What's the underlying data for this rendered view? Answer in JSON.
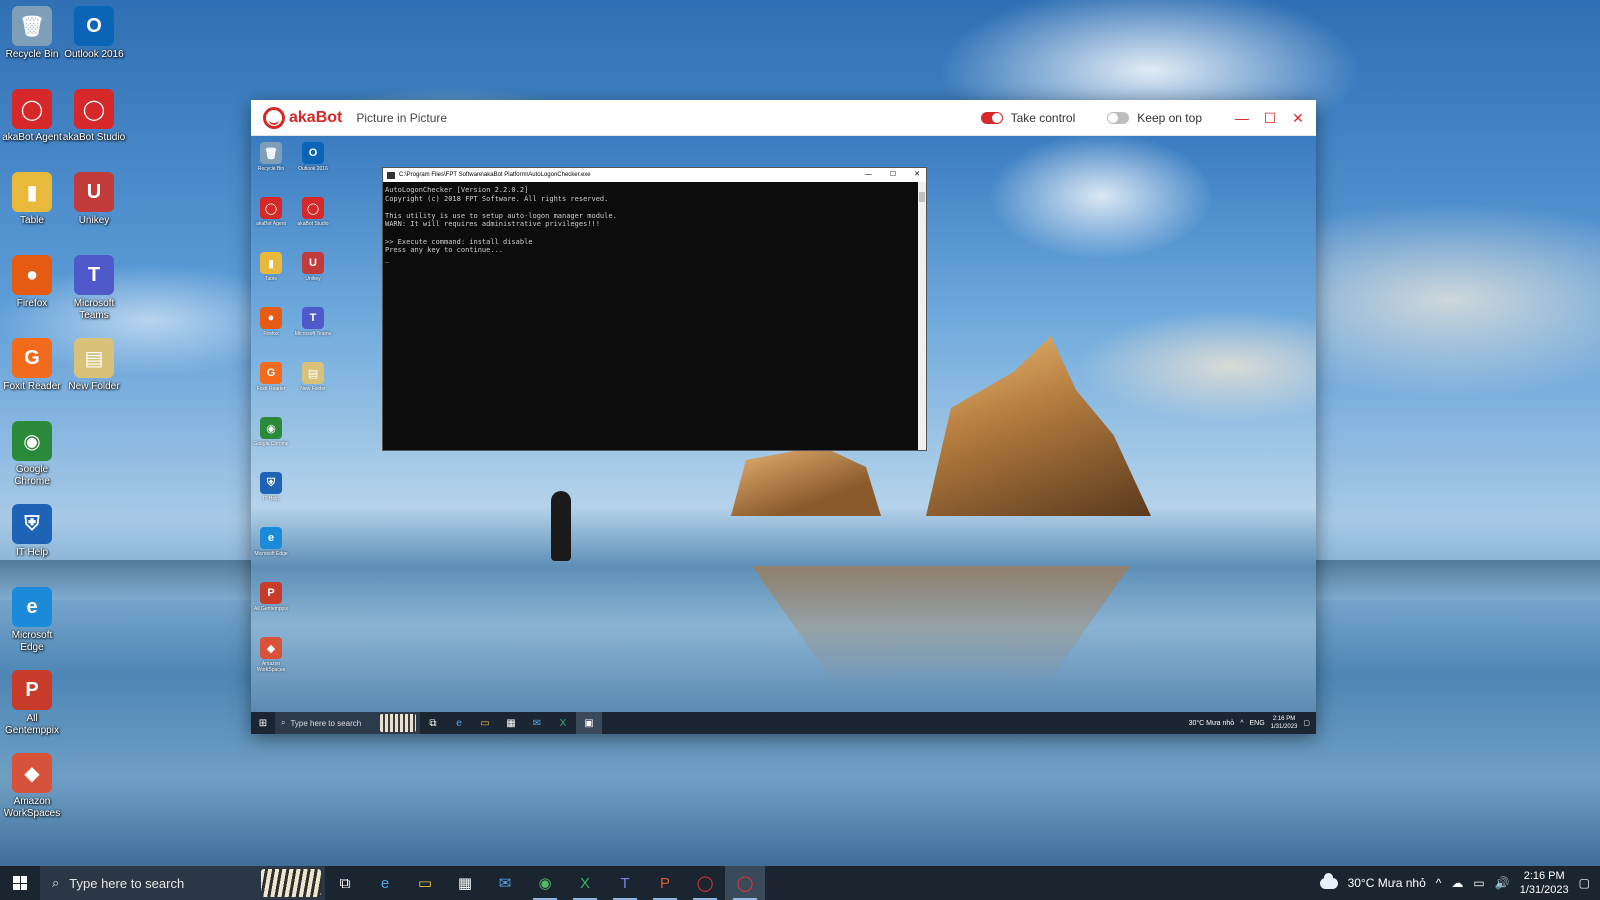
{
  "desktop_icons": [
    {
      "label": "Recycle Bin",
      "glyph": "🗑",
      "color": "#7f9fb8"
    },
    {
      "label": "Outlook 2016",
      "glyph": "O",
      "color": "#0a64b8"
    },
    {
      "label": "akaBot Agent",
      "glyph": "◯",
      "color": "#d62828"
    },
    {
      "label": "akaBot Studio",
      "glyph": "◯",
      "color": "#d62828"
    },
    {
      "label": "Table",
      "glyph": "▮",
      "color": "#e8b93a"
    },
    {
      "label": "Unikey",
      "glyph": "U",
      "color": "#c23a3a"
    },
    {
      "label": "Firefox",
      "glyph": "●",
      "color": "#e55b12"
    },
    {
      "label": "Microsoft Teams",
      "glyph": "T",
      "color": "#5059c9"
    },
    {
      "label": "Foxit Reader",
      "glyph": "G",
      "color": "#f26a1b"
    },
    {
      "label": "New Folder",
      "glyph": "▤",
      "color": "#d8c27a"
    },
    {
      "label": "Google Chrome",
      "glyph": "◉",
      "color": "#2a8a3a"
    },
    {
      "label": "IT Help",
      "glyph": "⛨",
      "color": "#1e63b5"
    },
    {
      "label": "Microsoft Edge",
      "glyph": "e",
      "color": "#1b8ad8"
    },
    {
      "label": "All Gentemppix",
      "glyph": "P",
      "color": "#c83a2a"
    },
    {
      "label": "Amazon WorkSpaces",
      "glyph": "◆",
      "color": "#d8523a"
    }
  ],
  "pip": {
    "brand": "akaBot",
    "subtitle": "Picture in Picture",
    "take_control_label": "Take control",
    "take_control_on": true,
    "keep_on_top_label": "Keep on top",
    "keep_on_top_on": false,
    "minimize": "—",
    "maximize": "☐",
    "close": "✕"
  },
  "remote": {
    "icons": [
      {
        "label": "Recycle Bin",
        "glyph": "🗑",
        "color": "#7f9fb8"
      },
      {
        "label": "Outlook 2016",
        "glyph": "O",
        "color": "#0a64b8"
      },
      {
        "label": "akaBot Agent",
        "glyph": "◯",
        "color": "#d62828"
      },
      {
        "label": "akaBot Studio",
        "glyph": "◯",
        "color": "#d62828"
      },
      {
        "label": "Table",
        "glyph": "▮",
        "color": "#e8b93a"
      },
      {
        "label": "Unikey",
        "glyph": "U",
        "color": "#c23a3a"
      },
      {
        "label": "Firefox",
        "glyph": "●",
        "color": "#e55b12"
      },
      {
        "label": "Microsoft Teams",
        "glyph": "T",
        "color": "#5059c9"
      },
      {
        "label": "Foxit Reader",
        "glyph": "G",
        "color": "#f26a1b"
      },
      {
        "label": "New Folder",
        "glyph": "▤",
        "color": "#d8c27a"
      },
      {
        "label": "Google Chrome",
        "glyph": "◉",
        "color": "#2a8a3a"
      },
      {
        "label": "IT Help",
        "glyph": "⛨",
        "color": "#1e63b5"
      },
      {
        "label": "Microsoft Edge",
        "glyph": "e",
        "color": "#1b8ad8"
      },
      {
        "label": "All Gentemppix",
        "glyph": "P",
        "color": "#c83a2a"
      },
      {
        "label": "Amazon WorkSpaces",
        "glyph": "◆",
        "color": "#d8523a"
      }
    ],
    "console": {
      "title": "C:\\Program Files\\FPT Software\\akaBot Platform\\AutoLogonChecker.exe",
      "lines": "AutoLogonChecker [Version 2.2.0.2]\nCopyright (c) 2018 FPT Software. All rights reserved.\n\nThis utility is use to setup auto-logon manager module.\nWARN: It will requires administrative privileges!!!\n\n>> Execute command: install disable\nPress any key to continue...\n_"
    },
    "taskbar": {
      "search_placeholder": "Type here to search",
      "weather": "30°C  Mưa nhỏ",
      "lang": "ENG",
      "time": "2:16 PM",
      "date": "1/31/2023"
    }
  },
  "taskbar": {
    "search_placeholder": "Type here to search",
    "apps": [
      {
        "name": "task-view",
        "glyph": "⧉"
      },
      {
        "name": "edge",
        "glyph": "e"
      },
      {
        "name": "file-explorer",
        "glyph": "▭"
      },
      {
        "name": "store",
        "glyph": "▦"
      },
      {
        "name": "mail",
        "glyph": "✉"
      },
      {
        "name": "chrome",
        "glyph": "◉"
      },
      {
        "name": "excel",
        "glyph": "X"
      },
      {
        "name": "teams",
        "glyph": "T"
      },
      {
        "name": "powerpoint",
        "glyph": "P"
      },
      {
        "name": "akabot-agent",
        "glyph": "◯"
      },
      {
        "name": "akabot-pip",
        "glyph": "◯"
      }
    ],
    "weather": "30°C  Mưa nhỏ",
    "time": "2:16 PM",
    "date": "1/31/2023"
  }
}
